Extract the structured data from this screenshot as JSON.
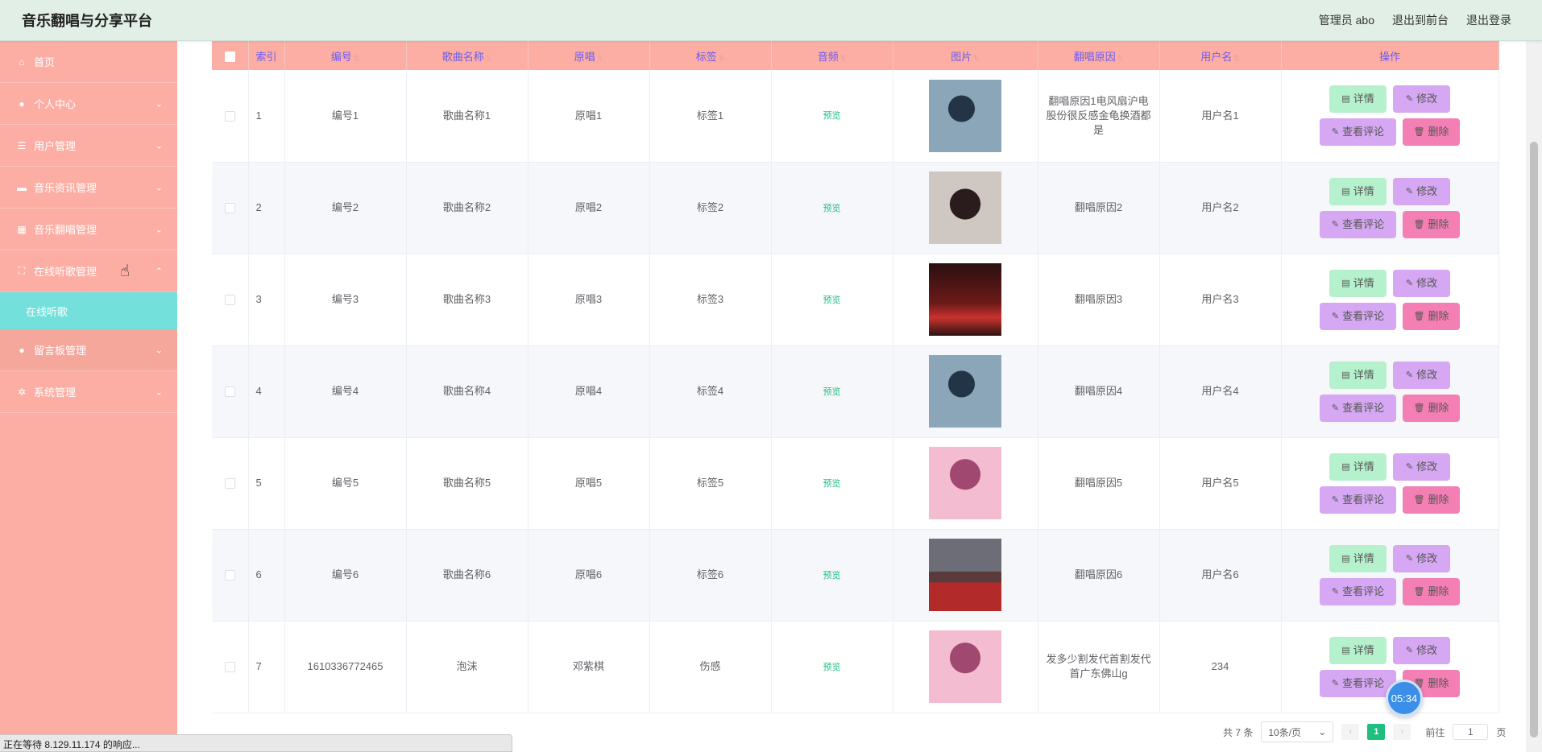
{
  "header": {
    "title": "音乐翻唱与分享平台",
    "admin": "管理员 abo",
    "front": "退出到前台",
    "logout": "退出登录"
  },
  "sidebar": {
    "items": [
      {
        "label": "首页",
        "icon": "home-icon",
        "expandable": false
      },
      {
        "label": "个人中心",
        "icon": "user-icon",
        "expandable": true
      },
      {
        "label": "用户管理",
        "icon": "list-icon",
        "expandable": true
      },
      {
        "label": "音乐资讯管理",
        "icon": "ticket-icon",
        "expandable": true
      },
      {
        "label": "音乐翻唱管理",
        "icon": "grid-icon",
        "expandable": true
      },
      {
        "label": "在线听歌管理",
        "icon": "fullscreen-icon",
        "expandable": true,
        "open": true
      }
    ],
    "submenu": "在线听歌",
    "items_after": [
      {
        "label": "留言板管理",
        "icon": "user-icon",
        "expandable": true
      },
      {
        "label": "系统管理",
        "icon": "settings-icon",
        "expandable": true
      }
    ]
  },
  "table": {
    "headers": [
      "索引",
      "编号",
      "歌曲名称",
      "原唱",
      "标签",
      "音频",
      "图片",
      "翻唱原因",
      "用户名",
      "操作"
    ],
    "preview_label": "预览",
    "buttons": {
      "detail": "详情",
      "edit": "修改",
      "comment": "查看评论",
      "delete": "删除"
    },
    "rows": [
      {
        "index": "1",
        "code": "编号1",
        "song": "歌曲名称1",
        "original": "原唱1",
        "tag": "标签1",
        "img": "img-a",
        "reason": "翻唱原因1电风扇沪电股份很反感金龟换酒都是",
        "user": "用户名1"
      },
      {
        "index": "2",
        "code": "编号2",
        "song": "歌曲名称2",
        "original": "原唱2",
        "tag": "标签2",
        "img": "img-b",
        "reason": "翻唱原因2",
        "user": "用户名2"
      },
      {
        "index": "3",
        "code": "编号3",
        "song": "歌曲名称3",
        "original": "原唱3",
        "tag": "标签3",
        "img": "img-c",
        "reason": "翻唱原因3",
        "user": "用户名3"
      },
      {
        "index": "4",
        "code": "编号4",
        "song": "歌曲名称4",
        "original": "原唱4",
        "tag": "标签4",
        "img": "img-a",
        "reason": "翻唱原因4",
        "user": "用户名4"
      },
      {
        "index": "5",
        "code": "编号5",
        "song": "歌曲名称5",
        "original": "原唱5",
        "tag": "标签5",
        "img": "img-d",
        "reason": "翻唱原因5",
        "user": "用户名5"
      },
      {
        "index": "6",
        "code": "编号6",
        "song": "歌曲名称6",
        "original": "原唱6",
        "tag": "标签6",
        "img": "img-e",
        "reason": "翻唱原因6",
        "user": "用户名6"
      },
      {
        "index": "7",
        "code": "1610336772465",
        "song": "泡沫",
        "original": "邓紫棋",
        "tag": "伤感",
        "img": "img-d",
        "reason": "发多少割发代首割发代首广东佛山g",
        "user": "234"
      }
    ]
  },
  "pager": {
    "total": "共 7 条",
    "size": "10条/页",
    "current": "1",
    "goto_prefix": "前往",
    "goto_value": "1",
    "goto_suffix": "页"
  },
  "status": "正在等待 8.129.11.174 的响应...",
  "timer": "05:34"
}
